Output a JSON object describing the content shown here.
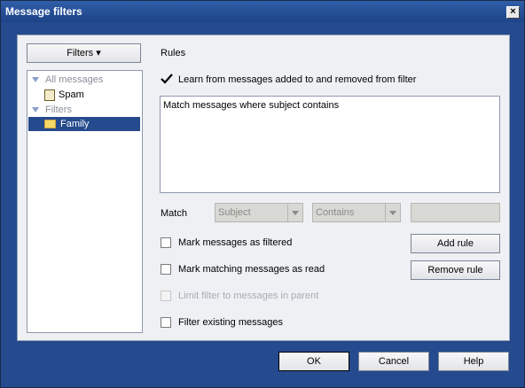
{
  "window": {
    "title": "Message filters",
    "close_glyph": "×"
  },
  "left": {
    "filters_button": "Filters ▾",
    "tree": [
      {
        "label": "All messages",
        "type": "group"
      },
      {
        "label": "Spam",
        "type": "item",
        "icon": "spam-icon"
      },
      {
        "label": "Filters",
        "type": "group"
      },
      {
        "label": "Family",
        "type": "item",
        "icon": "folder-icon",
        "selected": true
      }
    ]
  },
  "rules": {
    "heading": "Rules",
    "learn_label": "Learn from messages added to and removed from filter",
    "learn_checked": true,
    "text": "Match messages where subject contains",
    "match_label": "Match",
    "match_field": "Subject",
    "match_op": "Contains",
    "match_value": "",
    "options": [
      {
        "label": "Mark messages as filtered",
        "checked": false,
        "disabled": false
      },
      {
        "label": "Mark matching messages as read",
        "checked": false,
        "disabled": false
      },
      {
        "label": "Limit filter to messages in parent",
        "checked": false,
        "disabled": true
      },
      {
        "label": "Filter existing messages",
        "checked": false,
        "disabled": false
      }
    ],
    "add_rule": "Add rule",
    "remove_rule": "Remove rule"
  },
  "footer": {
    "ok": "OK",
    "cancel": "Cancel",
    "help": "Help"
  },
  "colors": {
    "title_bar": "#1e4388",
    "selection": "#254a8e",
    "panel": "#eef0f3"
  }
}
